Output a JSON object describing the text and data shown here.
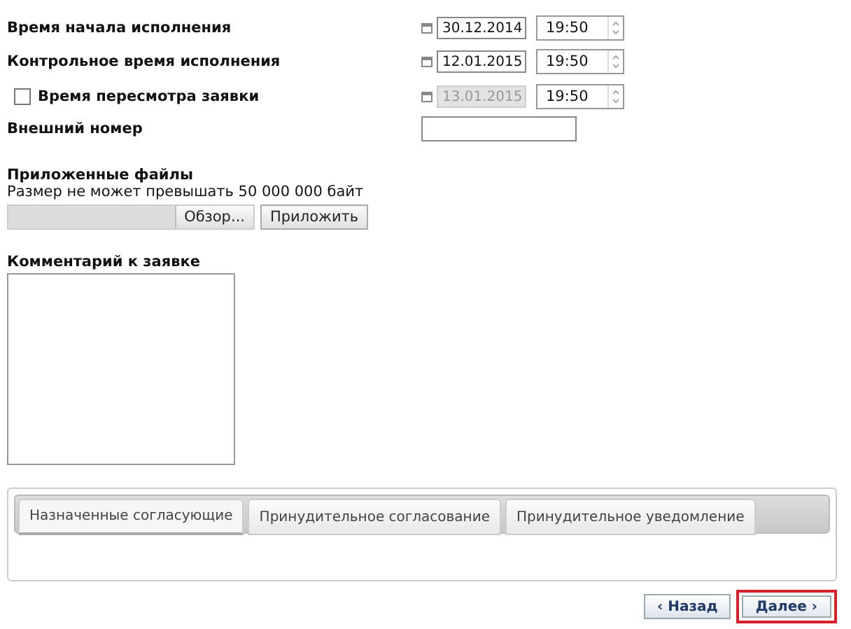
{
  "fields": [
    {
      "label": "Время начала исполнения",
      "kind": "plain",
      "date": "30.12.2014",
      "time": "19:50",
      "disabled": false
    },
    {
      "label": "Контрольное время исполнения",
      "kind": "plain",
      "date": "12.01.2015",
      "time": "19:50",
      "disabled": false
    },
    {
      "label": "Время пересмотра заявки",
      "kind": "checkbox",
      "checked": false,
      "date": "13.01.2015",
      "time": "19:50",
      "disabled": true
    }
  ],
  "external_number": {
    "label": "Внешний номер"
  },
  "attachments": {
    "title": "Приложенные файлы",
    "note": "Размер не может превышать 50 000 000 байт",
    "browse": "Обзор...",
    "attach": "Приложить"
  },
  "comment": {
    "label": "Комментарий к заявке"
  },
  "tabs": [
    {
      "label": "Назначенные согласующие",
      "selected": true
    },
    {
      "label": "Принудительное согласование",
      "selected": false
    },
    {
      "label": "Принудительное уведомление",
      "selected": false
    }
  ],
  "nav": [
    {
      "label": "‹ Назад",
      "highlighted": false
    },
    {
      "label": "Далее ›",
      "highlighted": true
    }
  ]
}
